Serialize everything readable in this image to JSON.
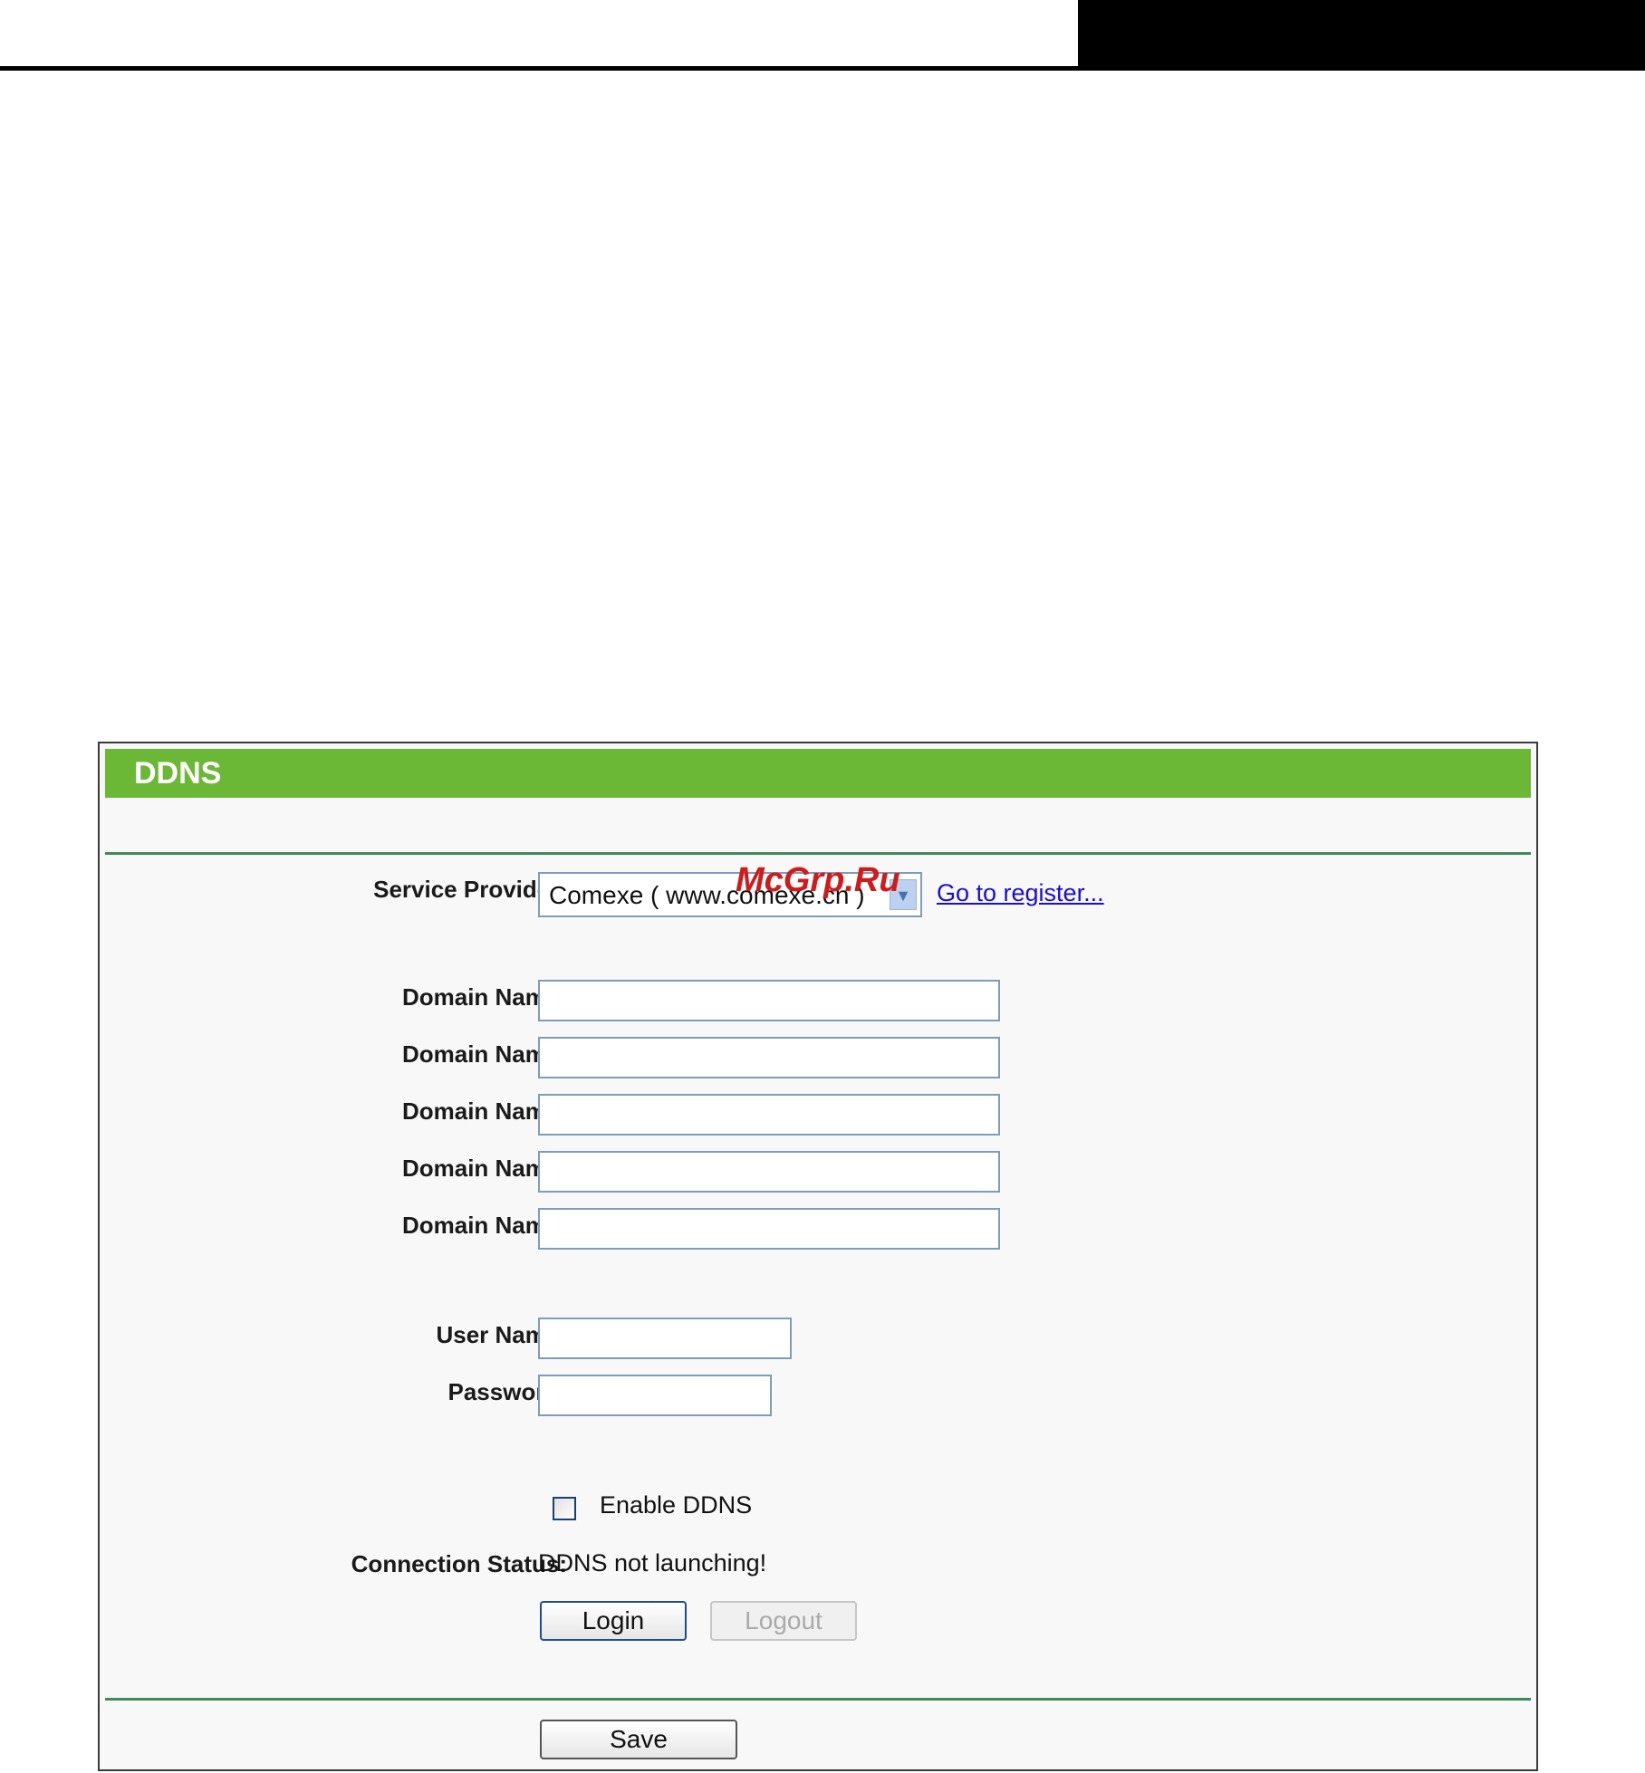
{
  "panel": {
    "title": "DDNS"
  },
  "service_provider": {
    "label": "Service Provider:",
    "value": "Comexe ( www.comexe.cn )",
    "register_link": "Go to register..."
  },
  "watermark": "McGrp.Ru",
  "domain_names": [
    {
      "label": "Domain Name:",
      "value": ""
    },
    {
      "label": "Domain Name:",
      "value": ""
    },
    {
      "label": "Domain Name:",
      "value": ""
    },
    {
      "label": "Domain Name:",
      "value": ""
    },
    {
      "label": "Domain Name:",
      "value": ""
    }
  ],
  "user_name": {
    "label": "User Name:",
    "value": ""
  },
  "password": {
    "label": "Password:",
    "value": ""
  },
  "enable_ddns": {
    "label": "Enable DDNS",
    "checked": false
  },
  "connection_status": {
    "label": "Connection Status:",
    "value": "DDNS not launching!"
  },
  "buttons": {
    "login": "Login",
    "logout": "Logout",
    "save": "Save"
  },
  "colors": {
    "title_bar": "#6ab835",
    "divider": "#3d8b5a",
    "link": "#1a0ddb"
  }
}
